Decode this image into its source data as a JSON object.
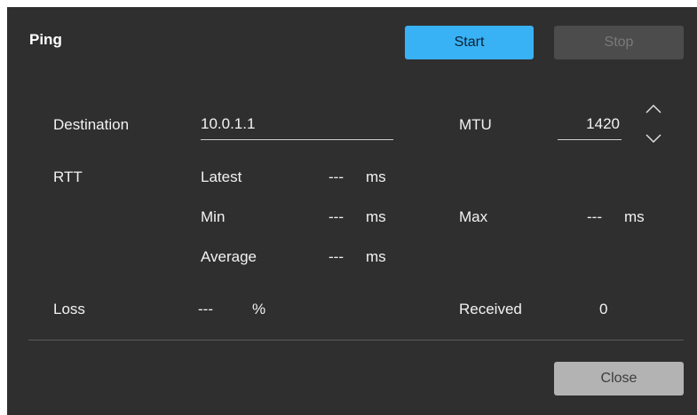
{
  "dialog": {
    "title": "Ping",
    "start_label": "Start",
    "stop_label": "Stop",
    "close_label": "Close"
  },
  "destination": {
    "label": "Destination",
    "value": "10.0.1.1"
  },
  "mtu": {
    "label": "MTU",
    "value": "1420"
  },
  "rtt": {
    "label": "RTT",
    "latest_label": "Latest",
    "latest_value": "---",
    "latest_unit": "ms",
    "min_label": "Min",
    "min_value": "---",
    "min_unit": "ms",
    "average_label": "Average",
    "average_value": "---",
    "average_unit": "ms",
    "max_label": "Max",
    "max_value": "---",
    "max_unit": "ms"
  },
  "loss": {
    "label": "Loss",
    "value": "---",
    "unit": "%"
  },
  "received": {
    "label": "Received",
    "value": "0"
  },
  "icons": {
    "up": "chevron-up-icon",
    "down": "chevron-down-icon"
  },
  "colors": {
    "background": "#2f2f2f",
    "accent": "#38b1f5",
    "disabled": "#4c4c4c",
    "close": "#b3b3b3"
  }
}
